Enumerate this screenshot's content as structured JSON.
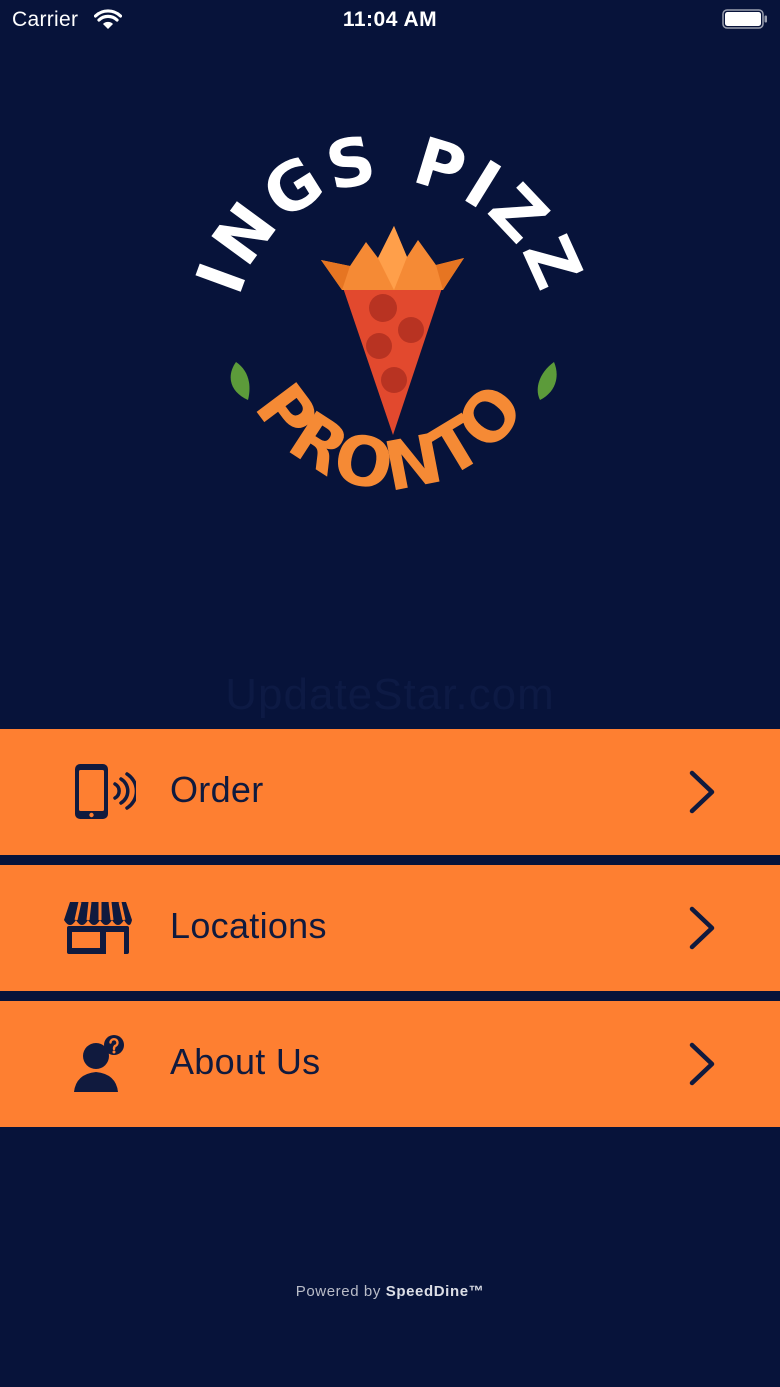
{
  "status_bar": {
    "carrier": "Carrier",
    "time": "11:04 AM",
    "wifi_icon": "wifi-icon",
    "battery_icon": "battery-full-icon"
  },
  "logo": {
    "top_text": "KINGS PIZZA",
    "bottom_text": "PRONTO",
    "icon": "pizza-slice-crown-icon"
  },
  "watermark": "UpdateStar.com",
  "menu": {
    "items": [
      {
        "label": "Order",
        "icon": "smartphone-signal-icon"
      },
      {
        "label": "Locations",
        "icon": "storefront-icon"
      },
      {
        "label": "About Us",
        "icon": "person-question-icon"
      }
    ],
    "chevron_icon": "chevron-right-icon"
  },
  "footer": {
    "prefix": "Powered by",
    "brand": "SpeedDine™"
  },
  "colors": {
    "background": "#07133a",
    "menu_orange": "#fe7f31",
    "menu_text": "#101a3e",
    "logo_orange": "#f58a35",
    "slice_red": "#e2492e",
    "leaf_green": "#5c9b3a"
  }
}
